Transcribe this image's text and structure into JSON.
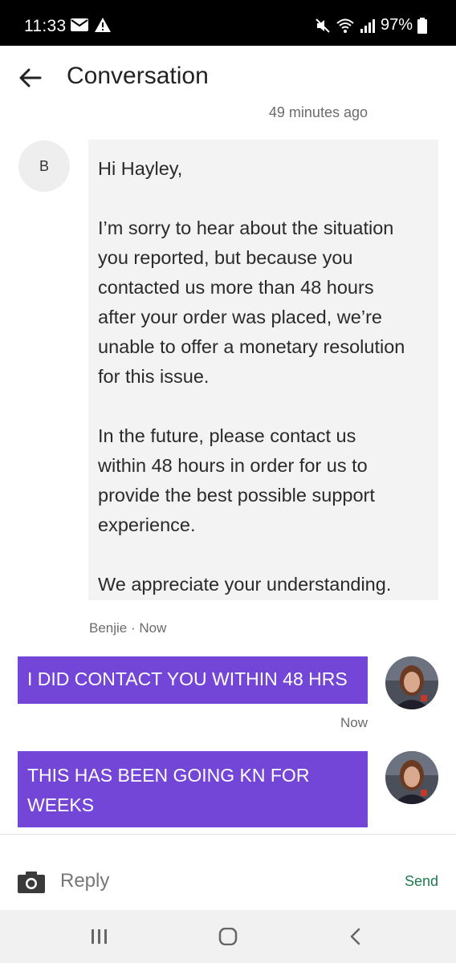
{
  "status_bar": {
    "time": "11:33",
    "battery": "97%",
    "icons": [
      "mail-icon",
      "alert-icon",
      "mute-icon",
      "wifi-icon",
      "signal-icon",
      "battery-icon"
    ]
  },
  "header": {
    "title": "Conversation",
    "back_icon": "arrow-left-icon"
  },
  "conversation": {
    "top_timestamp": "49 minutes ago",
    "incoming": {
      "avatar_letter": "B",
      "lines": [
        "Hi Hayley,",
        "",
        "I’m sorry to hear about the situation",
        "you reported, but because you",
        "contacted us more than 48 hours",
        "after your order was placed, we’re",
        "unable to offer a monetary resolution",
        "for this issue.",
        "",
        "In the future, please contact us",
        "within 48 hours in order for us to",
        "provide the best possible support",
        "experience.",
        "",
        "We appreciate your understanding."
      ],
      "meta": "Benjie · Now"
    },
    "outgoing": [
      {
        "lines": [
          "I DID CONTACT YOU WITHIN 48 HRS"
        ],
        "meta": "Now"
      },
      {
        "lines": [
          "THIS HAS BEEN GOING KN FOR",
          "WEEKS"
        ],
        "meta": ""
      }
    ]
  },
  "reply_bar": {
    "placeholder": "Reply",
    "send_label": "Send",
    "camera_icon": "camera-icon"
  },
  "nav_bar": {
    "icons": [
      "recents-icon",
      "home-icon",
      "back-icon"
    ]
  },
  "colors": {
    "outgoing_bubble": "#7346d8",
    "incoming_bubble": "#f3f3f3",
    "send_text": "#1f7a52",
    "status_bar": "#000000"
  }
}
